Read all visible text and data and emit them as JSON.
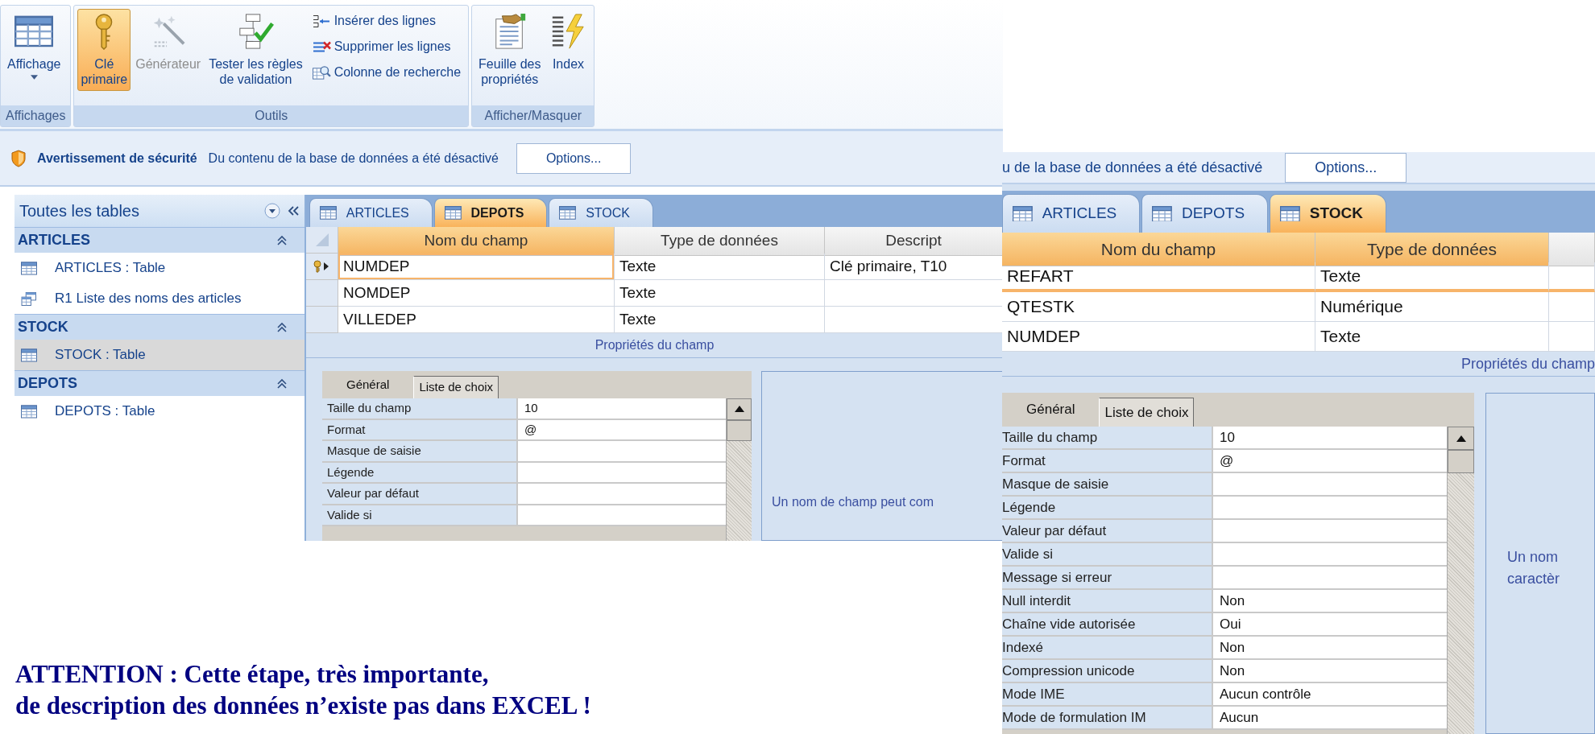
{
  "ribbon": {
    "groups": [
      {
        "label": "Affichages",
        "buttons": [
          {
            "kind": "large",
            "lines": [
              "Affichage"
            ],
            "dropdown": true,
            "selected": false,
            "disabled": false
          }
        ]
      },
      {
        "label": "Outils",
        "buttons": [
          {
            "kind": "large",
            "lines": [
              "Clé",
              "primaire"
            ],
            "selected": true,
            "disabled": false
          },
          {
            "kind": "large",
            "lines": [
              "Générateur"
            ],
            "selected": false,
            "disabled": true
          },
          {
            "kind": "large",
            "lines": [
              "Tester les règles",
              "de validation"
            ],
            "selected": false,
            "disabled": false
          },
          {
            "kind": "small",
            "lines": [
              "Insérer des lignes"
            ],
            "selected": false,
            "disabled": false
          },
          {
            "kind": "small",
            "lines": [
              "Supprimer les lignes"
            ],
            "selected": false,
            "disabled": false
          },
          {
            "kind": "small",
            "lines": [
              "Colonne de recherche"
            ],
            "selected": false,
            "disabled": false
          }
        ]
      },
      {
        "label": "Afficher/Masquer",
        "buttons": [
          {
            "kind": "large",
            "lines": [
              "Feuille des",
              "propriétés"
            ],
            "selected": false,
            "disabled": false
          },
          {
            "kind": "large",
            "lines": [
              "Index"
            ],
            "selected": false,
            "disabled": false
          }
        ]
      }
    ]
  },
  "security_bar": {
    "title": "Avertissement de sécurité",
    "message": "Du contenu de la base de données a été désactivé",
    "button": "Options..."
  },
  "navigation": {
    "title": "Toutes les tables",
    "groups": [
      {
        "name": "ARTICLES",
        "expanded": true,
        "items": [
          {
            "label": "ARTICLES : Table",
            "kind": "table",
            "selected": false
          },
          {
            "label": "R1 Liste des noms des articles",
            "kind": "query",
            "selected": false
          }
        ]
      },
      {
        "name": "STOCK",
        "expanded": true,
        "items": [
          {
            "label": "STOCK : Table",
            "kind": "table",
            "selected": true
          }
        ]
      },
      {
        "name": "DEPOTS",
        "expanded": true,
        "items": [
          {
            "label": "DEPOTS : Table",
            "kind": "table",
            "selected": false
          }
        ]
      }
    ]
  },
  "depots_designer": {
    "tabs": [
      {
        "label": "ARTICLES",
        "selected": false
      },
      {
        "label": "DEPOTS",
        "selected": true
      },
      {
        "label": "STOCK",
        "selected": false
      }
    ],
    "columns": [
      {
        "label": "Nom du champ",
        "highlighted": true
      },
      {
        "label": "Type de données",
        "highlighted": false
      },
      {
        "label": "Descript",
        "highlighted": false
      }
    ],
    "rows": [
      {
        "cells": [
          "NUMDEP",
          "Texte",
          "Clé primaire, T10"
        ],
        "primary_key": true,
        "selected": true
      },
      {
        "cells": [
          "NOMDEP",
          "Texte"
        ],
        "primary_key": false,
        "selected": false
      },
      {
        "cells": [
          "VILLEDEP",
          "Texte"
        ],
        "primary_key": false,
        "selected": false
      }
    ],
    "caption": "Propriétés du champ",
    "property_tabs": [
      {
        "label": "Général",
        "selected": true
      },
      {
        "label": "Liste de choix",
        "selected": false
      }
    ],
    "properties": [
      {
        "label": "Taille du champ",
        "value": "10"
      },
      {
        "label": "Format",
        "value": "@"
      },
      {
        "label": "Masque de saisie"
      },
      {
        "label": "Légende"
      },
      {
        "label": "Valeur par défaut"
      },
      {
        "label": "Valide si"
      }
    ],
    "help_lines": [
      "Un nom de champ peut com"
    ]
  },
  "stock_designer": {
    "security_message": "u de la base de données a été désactivé",
    "security_button": "Options...",
    "tabs": [
      {
        "label": "ARTICLES",
        "selected": false
      },
      {
        "label": "DEPOTS",
        "selected": false
      },
      {
        "label": "STOCK",
        "selected": true
      }
    ],
    "columns": [
      {
        "label": "Nom du champ",
        "highlighted": true
      },
      {
        "label": "Type de données",
        "highlighted": true
      }
    ],
    "rows": [
      {
        "cells": [
          "REFART",
          "Texte"
        ],
        "selected": true
      },
      {
        "cells": [
          "QTESTK",
          "Numérique"
        ],
        "selected": false
      },
      {
        "cells": [
          "NUMDEP",
          "Texte"
        ],
        "selected": false
      }
    ],
    "caption": "Propriétés du champ",
    "property_tabs": [
      {
        "label": "Général",
        "selected": true
      },
      {
        "label": "Liste de choix",
        "selected": false
      }
    ],
    "properties": [
      {
        "label": "Taille du champ",
        "value": "10"
      },
      {
        "label": "Format",
        "value": "@"
      },
      {
        "label": "Masque de saisie"
      },
      {
        "label": "Légende"
      },
      {
        "label": "Valeur par défaut"
      },
      {
        "label": "Valide si"
      },
      {
        "label": "Message si erreur"
      },
      {
        "label": "Null interdit",
        "value": "Non"
      },
      {
        "label": "Chaîne vide autorisée",
        "value": "Oui"
      },
      {
        "label": "Indexé",
        "value": "Non"
      },
      {
        "label": "Compression unicode",
        "value": "Non"
      },
      {
        "label": "Mode IME",
        "value": "Aucun contrôle"
      },
      {
        "label": "Mode de formulation IM",
        "value": "Aucun"
      }
    ],
    "help_lines": [
      "Un nom",
      "caractèr"
    ]
  },
  "note": {
    "lines": [
      "ATTENTION : Cette étape, très importante,",
      "de description des données n’existe pas dans EXCEL !"
    ]
  }
}
